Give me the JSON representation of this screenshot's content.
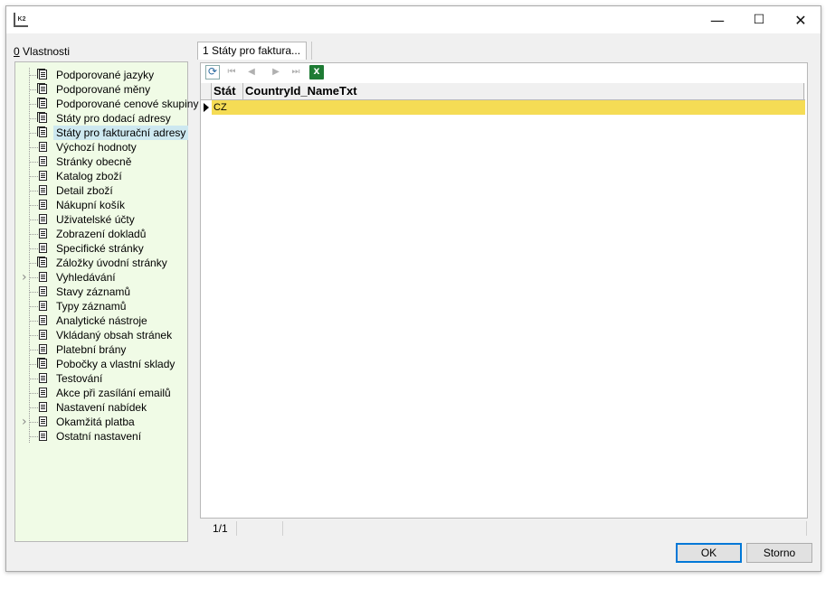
{
  "window": {
    "icon_text": "K2",
    "controls": {
      "minimize": "—",
      "maximize": "☐",
      "close": "✕"
    }
  },
  "left_panel": {
    "label_mnemonic": "0",
    "label_rest": " Vlastnosti",
    "items": [
      {
        "label": "Podporované jazyky",
        "icon": "multi-document-icon"
      },
      {
        "label": "Podporované měny",
        "icon": "multi-document-icon"
      },
      {
        "label": "Podporované cenové skupiny",
        "icon": "multi-document-icon"
      },
      {
        "label": "Státy pro dodací adresy",
        "icon": "multi-document-icon"
      },
      {
        "label": "Státy pro fakturační adresy",
        "icon": "multi-document-icon",
        "selected": true
      },
      {
        "label": "Výchozí hodnoty",
        "icon": "document-icon"
      },
      {
        "label": "Stránky obecně",
        "icon": "document-icon"
      },
      {
        "label": "Katalog zboží",
        "icon": "document-icon"
      },
      {
        "label": "Detail zboží",
        "icon": "document-icon"
      },
      {
        "label": "Nákupní košík",
        "icon": "document-icon"
      },
      {
        "label": "Uživatelské účty",
        "icon": "document-icon"
      },
      {
        "label": "Zobrazení dokladů",
        "icon": "document-icon"
      },
      {
        "label": "Specifické stránky",
        "icon": "document-icon"
      },
      {
        "label": "Záložky úvodní stránky",
        "icon": "multi-document-icon"
      },
      {
        "label": "Vyhledávání",
        "icon": "document-icon",
        "expandable": true
      },
      {
        "label": "Stavy záznamů",
        "icon": "document-icon"
      },
      {
        "label": "Typy záznamů",
        "icon": "document-icon"
      },
      {
        "label": "Analytické nástroje",
        "icon": "document-icon"
      },
      {
        "label": "Vkládaný obsah stránek",
        "icon": "document-icon"
      },
      {
        "label": "Platební brány",
        "icon": "document-icon"
      },
      {
        "label": "Pobočky a vlastní sklady",
        "icon": "multi-document-icon"
      },
      {
        "label": "Testování",
        "icon": "document-icon"
      },
      {
        "label": "Akce při zasílání emailů",
        "icon": "document-icon"
      },
      {
        "label": "Nastavení nabídek",
        "icon": "document-icon"
      },
      {
        "label": "Okamžitá platba",
        "icon": "document-icon",
        "expandable": true
      },
      {
        "label": "Ostatní nastavení",
        "icon": "document-icon"
      }
    ]
  },
  "tab": {
    "label": "1 Státy pro faktura..."
  },
  "toolbar": {
    "refresh": "⟳",
    "first": "⏮",
    "prev": "◀",
    "next": "▶",
    "last": "⏭",
    "export": "X"
  },
  "grid": {
    "columns": [
      "Stát",
      "CountryId_NameTxt"
    ],
    "rows": [
      {
        "stat": "CZ",
        "country_name": ""
      }
    ],
    "row_highlight_color": "#f5dc55"
  },
  "status": {
    "position": "1/1"
  },
  "buttons": {
    "ok": "OK",
    "cancel": "Storno"
  }
}
